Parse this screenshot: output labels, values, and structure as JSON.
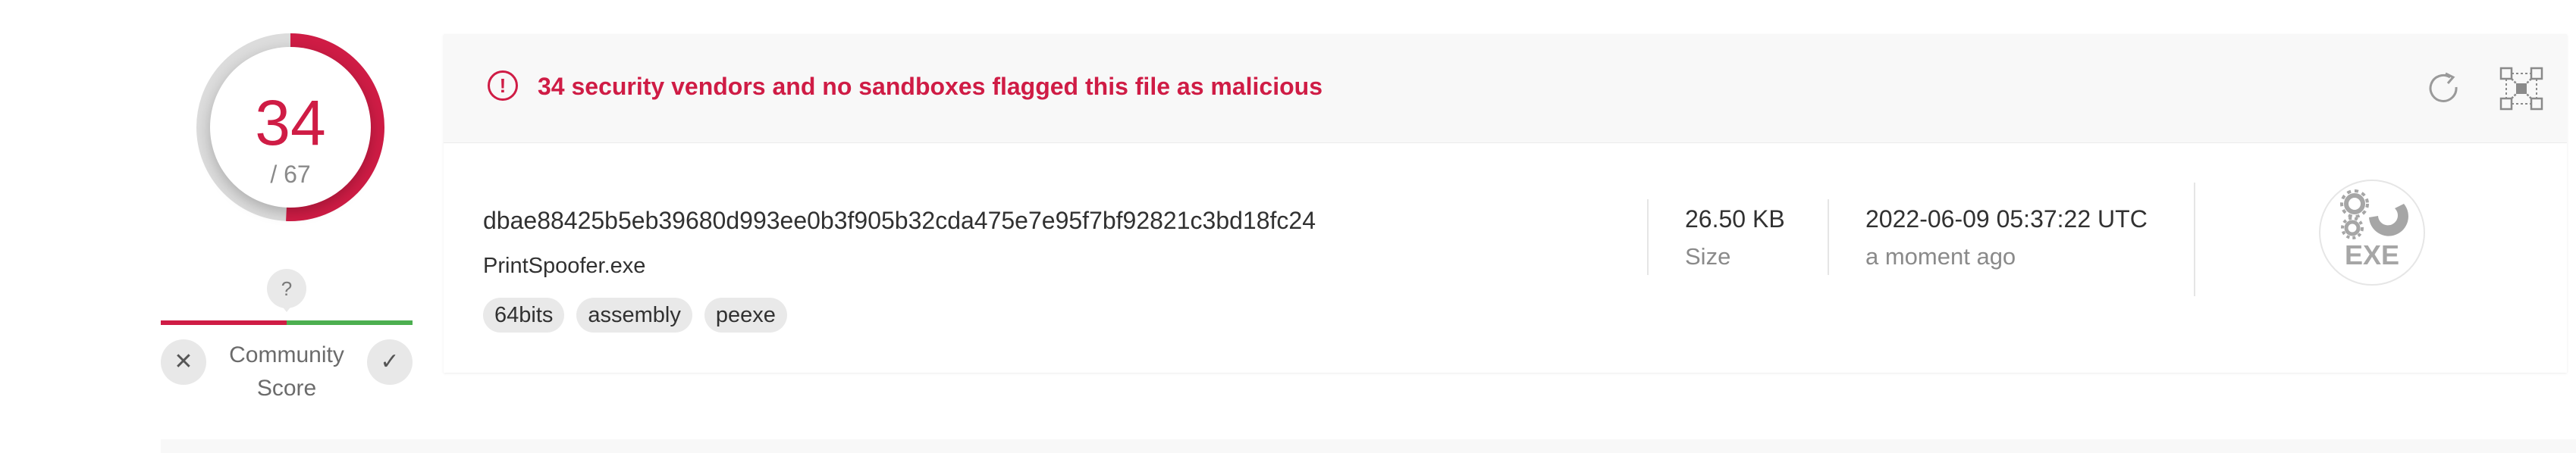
{
  "detection": {
    "positives": "34",
    "total_label": "/ 67",
    "positives_count": 34,
    "total_count": 67,
    "accent_color": "#cf1c45"
  },
  "community": {
    "unknown_symbol": "?",
    "label_line1": "Community",
    "label_line2": "Score",
    "vote_down_symbol": "✕",
    "vote_up_symbol": "✓",
    "negative_share": 0.5,
    "negative_color": "#cf1c45",
    "positive_color": "#4caf50"
  },
  "alert": {
    "icon_symbol": "!",
    "message": "34 security vendors and no sandboxes flagged this file as malicious",
    "reanalyze_icon": "reanalyze-icon",
    "graph_icon": "graph-icon"
  },
  "file": {
    "hash": "dbae88425b5eb39680d993ee0b3f905b32cda475e7e95f7bf92821c3bd18fc24",
    "name": "PrintSpoofer.exe",
    "tags": [
      "64bits",
      "assembly",
      "peexe"
    ],
    "size_value": "26.50 KB",
    "size_label": "Size",
    "date_value": "2022-06-09 05:37:22 UTC",
    "date_relative": "a moment ago",
    "type_label": "EXE",
    "type_icon": "gears-icon"
  }
}
